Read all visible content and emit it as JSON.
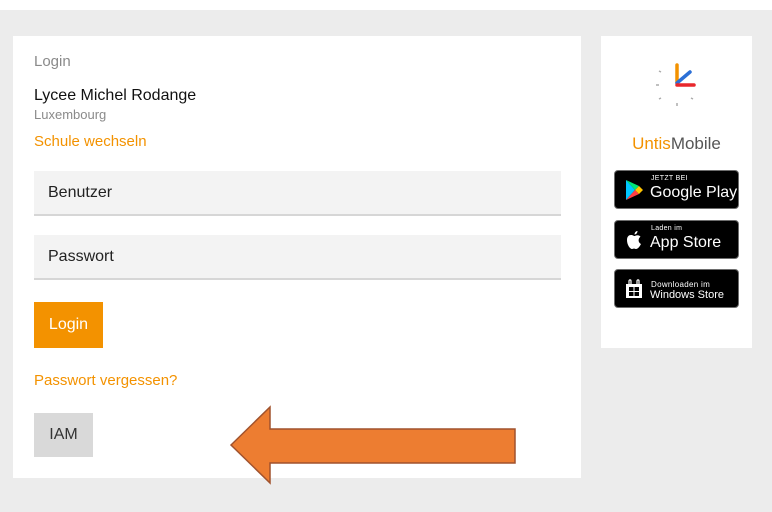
{
  "login_form": {
    "title": "Login",
    "school_name": "Lycee Michel Rodange",
    "school_city": "Luxembourg",
    "change_school_link": "Schule wechseln",
    "username_placeholder": "Benutzer",
    "password_placeholder": "Passwort",
    "login_button": "Login",
    "forgot_password_link": "Passwort vergessen?",
    "iam_button": "IAM"
  },
  "sidebar": {
    "brand_untis": "Untis",
    "brand_mobile": "Mobile",
    "badges": [
      {
        "icon": "google-play-icon",
        "small": "JETZT BEI",
        "big": "Google Play"
      },
      {
        "icon": "apple-icon",
        "small": "Laden im",
        "big": "App Store"
      },
      {
        "icon": "windows-store-icon",
        "small": "Downloaden im",
        "big": "Windows Store"
      }
    ]
  },
  "colors": {
    "accent": "#f39200",
    "background": "#ececec",
    "card": "#ffffff",
    "arrow": "#ed7d31",
    "arrow_outline": "#a0522d",
    "secondary_button": "#d9d9d9"
  }
}
